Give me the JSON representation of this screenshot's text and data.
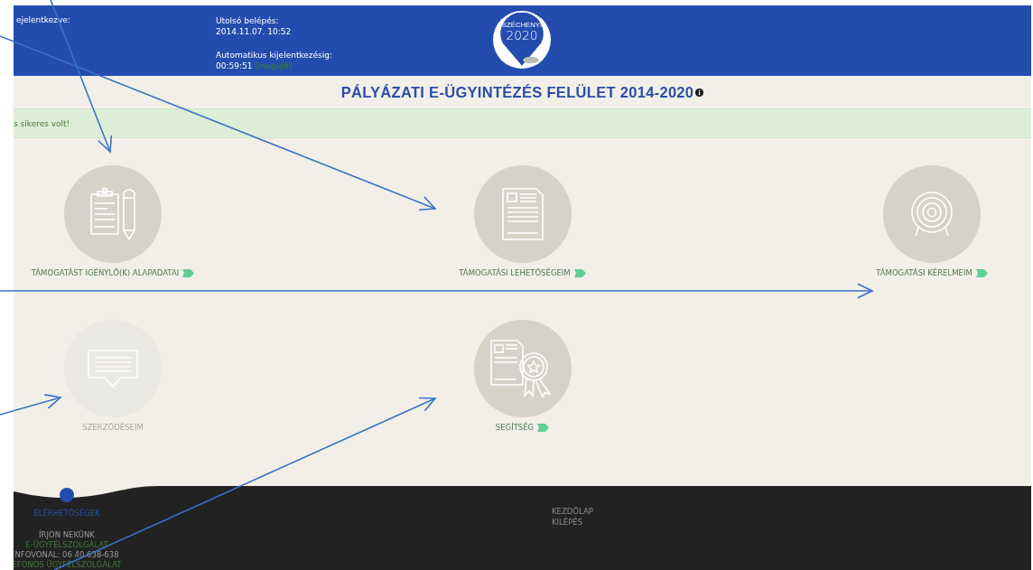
{
  "header": {
    "logged_in_label": "ejelentkezve:",
    "last_login_label": "Utolsó belépés:",
    "last_login": "2014.11.07. 10:52",
    "auto_logout_label": "Automatikus kijelentkezésig:",
    "auto_logout_time": "00:59:51",
    "renew_link": "[megújít]",
    "logo": {
      "small": "SZÉCHENYI",
      "big": "2020"
    }
  },
  "title": "PÁLYÁZATI E-ÜGYINTÉZÉS FELÜLET 2014-2020",
  "alert": "s sikeres volt!",
  "tiles": [
    {
      "label": "TÁMOGATÁST IGÉNYLŐ(K) ALAPADATAI",
      "kind": "clipboard",
      "disabled": false
    },
    {
      "label": "TÁMOGATÁSI LEHETŐSÉGEIM",
      "kind": "document",
      "disabled": false
    },
    {
      "label": "TÁMOGATÁSI KÉRELMEIM",
      "kind": "target",
      "disabled": false
    },
    {
      "label": "SZERZŐDÉSEIM",
      "kind": "speech",
      "disabled": true
    },
    {
      "label": "SEGÍTSÉG",
      "kind": "certificate",
      "disabled": false
    }
  ],
  "footer": {
    "heading": "ELÉRHETŐSÉGEK",
    "items": [
      {
        "text": "ÍRJON NEKÜNK",
        "kind": "text"
      },
      {
        "text": "E-ÜGYFÉLSZOLGÁLAT",
        "kind": "link"
      },
      {
        "text": "NFOVONAL: 06 40 638-638",
        "kind": "text"
      },
      {
        "text": "EFONOS ÜGYFÉLSZOLGÁLAT",
        "kind": "link"
      }
    ],
    "links": [
      "KEZDŐLAP",
      "KILÉPÉS"
    ]
  }
}
